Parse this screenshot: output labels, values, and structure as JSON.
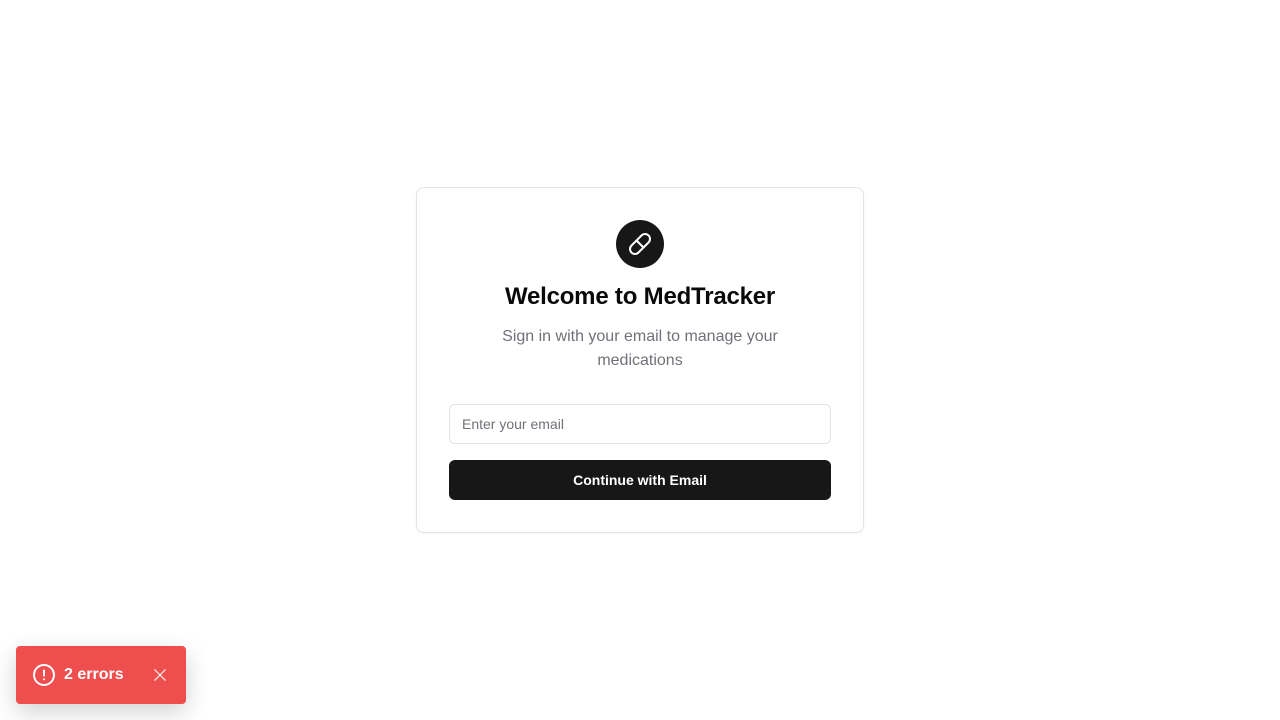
{
  "app": {
    "logo_icon": "pill-icon",
    "title": "Welcome to MedTracker",
    "subtitle": "Sign in with your email to manage your medications"
  },
  "form": {
    "email_placeholder": "Enter your email",
    "email_value": "",
    "submit_label": "Continue with Email"
  },
  "toast": {
    "icon": "alert-circle-icon",
    "label": "2 errors",
    "close_icon": "close-icon",
    "color": "#ef4e4e"
  },
  "colors": {
    "primary": "#171717",
    "muted_text": "#71717a",
    "border": "#e4e4e7"
  }
}
